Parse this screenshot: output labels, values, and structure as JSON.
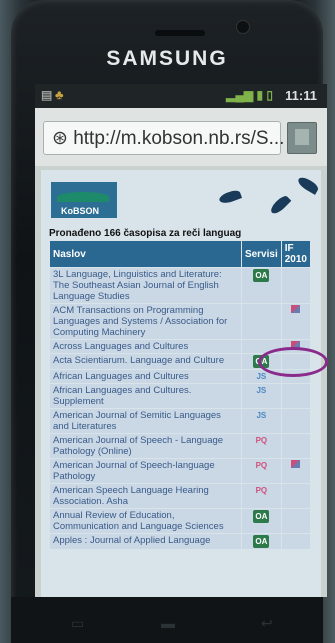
{
  "device": {
    "brand": "SAMSUNG",
    "clock": "11:11"
  },
  "browser": {
    "url": "http://m.kobson.nb.rs/S..."
  },
  "page": {
    "logo_text": "KoBSON",
    "heading": "Pronađeno 166 časopisa za reči languag",
    "columns": {
      "title": "Naslov",
      "services": "Servisi",
      "if_line1": "IF",
      "if_line2": "2010"
    },
    "rows": [
      {
        "title": "3L Language, Linguistics and Literature: The Southeast Asian Journal of English Language Studies",
        "service": "OA",
        "if_icon": ""
      },
      {
        "title": "ACM Transactions on Programming Languages and Systems / Association for Computing Machinery",
        "service": "",
        "if_icon": "flag-icon"
      },
      {
        "title": "Across Languages and Cultures",
        "service": "",
        "if_icon": "flag-icon"
      },
      {
        "title": "Acta Scientiarum. Language and Culture",
        "service": "OA",
        "if_icon": ""
      },
      {
        "title": "African Languages and Cultures",
        "service": "JS",
        "if_icon": ""
      },
      {
        "title": "African Languages and Cultures. Supplement",
        "service": "JS",
        "if_icon": ""
      },
      {
        "title": "American Journal of Semitic Languages and Literatures",
        "service": "JS",
        "if_icon": ""
      },
      {
        "title": "American Journal of Speech - Language Pathology (Online)",
        "service": "PQ",
        "if_icon": ""
      },
      {
        "title": "American Journal of Speech-language Pathology",
        "service": "PQ",
        "if_icon": "flag-icon"
      },
      {
        "title": "American Speech Language Hearing Association. Asha",
        "service": "PQ",
        "if_icon": ""
      },
      {
        "title": "Annual Review of Education, Communication and Language Sciences",
        "service": "OA",
        "if_icon": ""
      },
      {
        "title": "Apples : Journal of Applied Language",
        "service": "OA",
        "if_icon": ""
      }
    ]
  }
}
